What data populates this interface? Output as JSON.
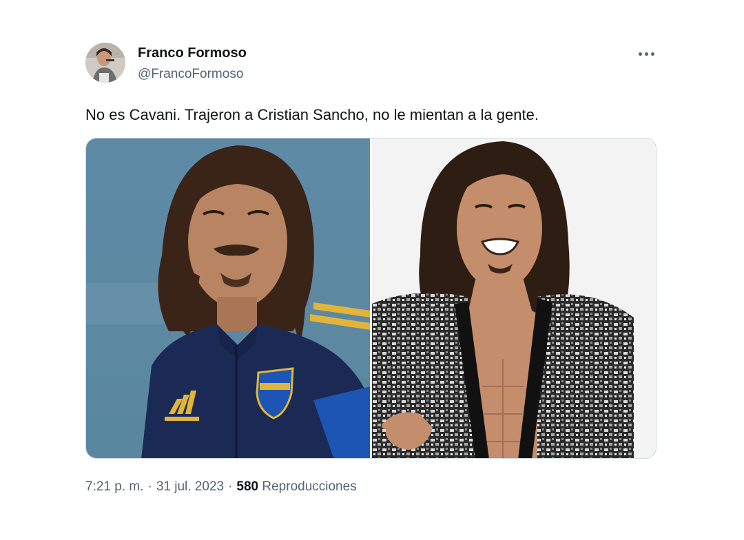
{
  "author": {
    "name": "Franco Formoso",
    "handle": "@FrancoFormoso"
  },
  "tweet": {
    "text": "No es Cavani. Trajeron a Cristian Sancho, no le mientan a la gente."
  },
  "meta": {
    "time": "7:21 p. m.",
    "separator": "·",
    "date": "31 jul. 2023",
    "views_count": "580",
    "views_label": "Reproducciones"
  },
  "colors": {
    "text_primary": "#0f1419",
    "text_secondary": "#536471",
    "border": "#cfd9de",
    "jacket_navy": "#1b2a55",
    "badge_gold": "#e2b43a"
  },
  "icons": {
    "more": "more-horizontal-icon"
  }
}
